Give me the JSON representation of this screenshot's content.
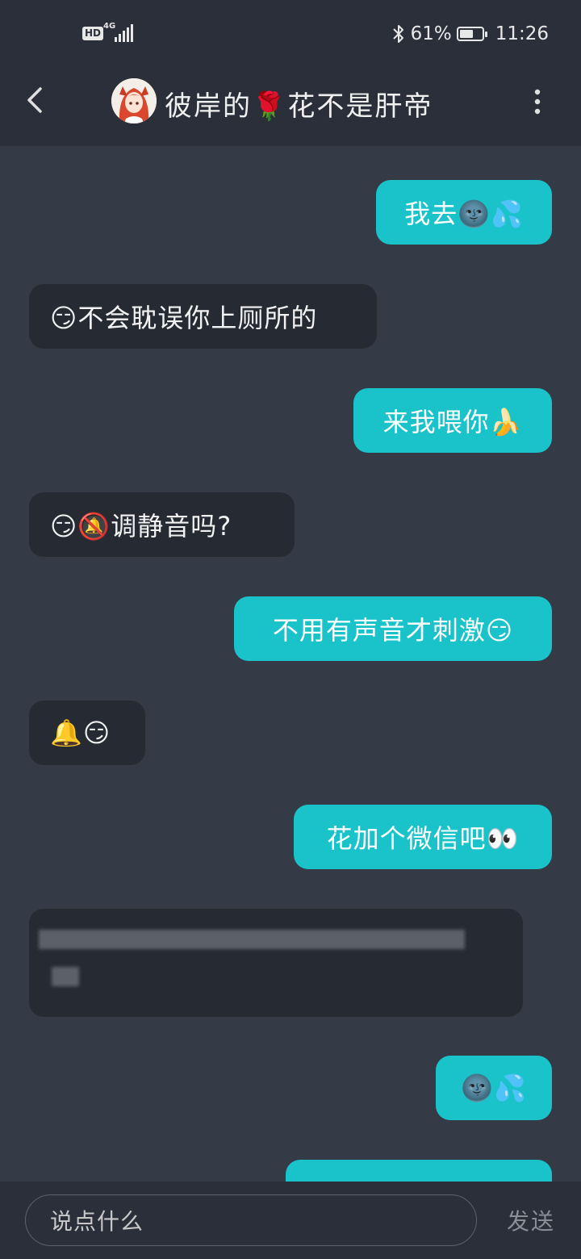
{
  "status_bar": {
    "network_hd": "HD",
    "network_type": "4G",
    "battery_percent": "61%",
    "battery_level": 0.61,
    "time": "11:26",
    "icons": [
      "bluetooth-icon",
      "battery-icon",
      "signal-icon"
    ]
  },
  "header": {
    "title": "彼岸的🌹花不是肝帝",
    "back_icon": "chevron-left-icon",
    "more_icon": "more-vertical-icon"
  },
  "messages": [
    {
      "side": "out",
      "text": "我去🌚💦"
    },
    {
      "side": "in",
      "text": "😏不会耽误你上厕所的"
    },
    {
      "side": "out",
      "text": "来我喂你🍌"
    },
    {
      "side": "in",
      "text": "😏🔕调静音吗?"
    },
    {
      "side": "out",
      "text": "不用有声音才刺激😏"
    },
    {
      "side": "in",
      "text": "🔔😏"
    },
    {
      "side": "out",
      "text": "花加个微信吧👀"
    },
    {
      "side": "in",
      "text": "",
      "blurred": true
    },
    {
      "side": "out",
      "text": "🌚💦"
    }
  ],
  "input": {
    "placeholder": "说点什么",
    "send_label": "发送"
  },
  "colors": {
    "background": "#353a47",
    "bar": "#2a2f3a",
    "outgoing_bubble": "#19c3c9",
    "incoming_bubble": "#252a33"
  }
}
